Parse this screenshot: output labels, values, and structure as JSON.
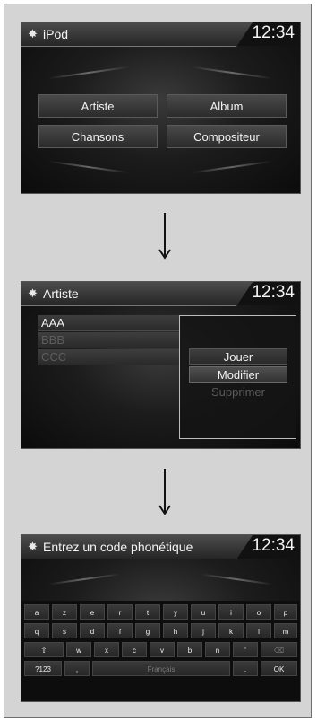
{
  "clock": "12:34",
  "screen1": {
    "title": "iPod",
    "buttons": [
      "Artiste",
      "Album",
      "Chansons",
      "Compositeur"
    ]
  },
  "screen2": {
    "title": "Artiste",
    "list": [
      "AAA",
      "BBB",
      "CCC"
    ],
    "popup": [
      "Jouer",
      "Modifier",
      "Supprimer"
    ]
  },
  "screen3": {
    "title": "Entrez un code phonétique",
    "rows": [
      [
        "a",
        "z",
        "e",
        "r",
        "t",
        "y",
        "u",
        "i",
        "o",
        "p"
      ],
      [
        "q",
        "s",
        "d",
        "f",
        "g",
        "h",
        "j",
        "k",
        "l",
        "m"
      ],
      [
        "⇧",
        "w",
        "x",
        "c",
        "v",
        "b",
        "n",
        "'",
        "⌫"
      ],
      [
        "?123",
        ",",
        "Français",
        ".",
        "OK"
      ]
    ]
  },
  "icons": [
    "settings-icon",
    "arrow-down-icon"
  ],
  "colors": {
    "screen_bg": "#111111",
    "page_bg": "#d4d4d4",
    "text": "#f2f2f2",
    "disabled": "#6a6a6a"
  }
}
